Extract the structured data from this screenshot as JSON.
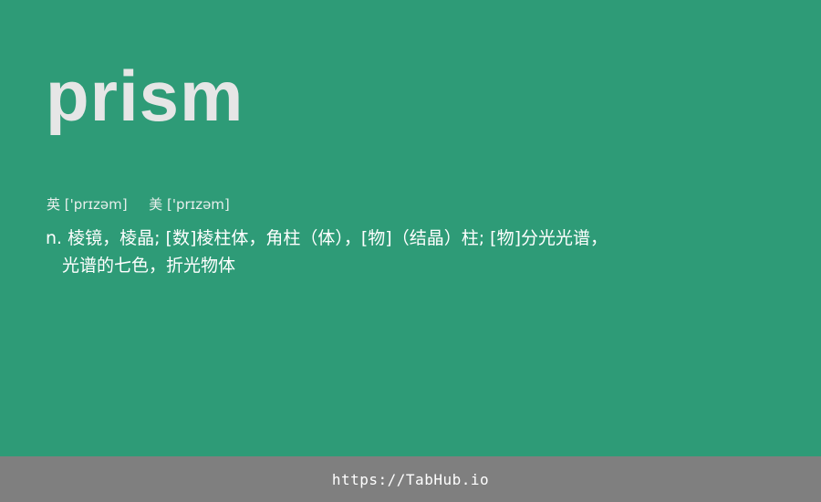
{
  "card": {
    "word": "prism",
    "phonetic_uk_label": "英",
    "phonetic_uk": "['prɪzəm]",
    "phonetic_us_label": "美",
    "phonetic_us": "['prɪzəm]",
    "definition_line1": "n. 棱镜，棱晶; [数]棱柱体，角柱（体），[物]（结晶）柱; [物]分光光谱，",
    "definition_line2": "光谱的七色，折光物体"
  },
  "footer": {
    "link_text": "https://TabHub.io"
  },
  "colors": {
    "background": "#2e9b77",
    "footer_background": "#7f7f7f",
    "word": "#e6e6e6",
    "text": "#ffffff"
  }
}
